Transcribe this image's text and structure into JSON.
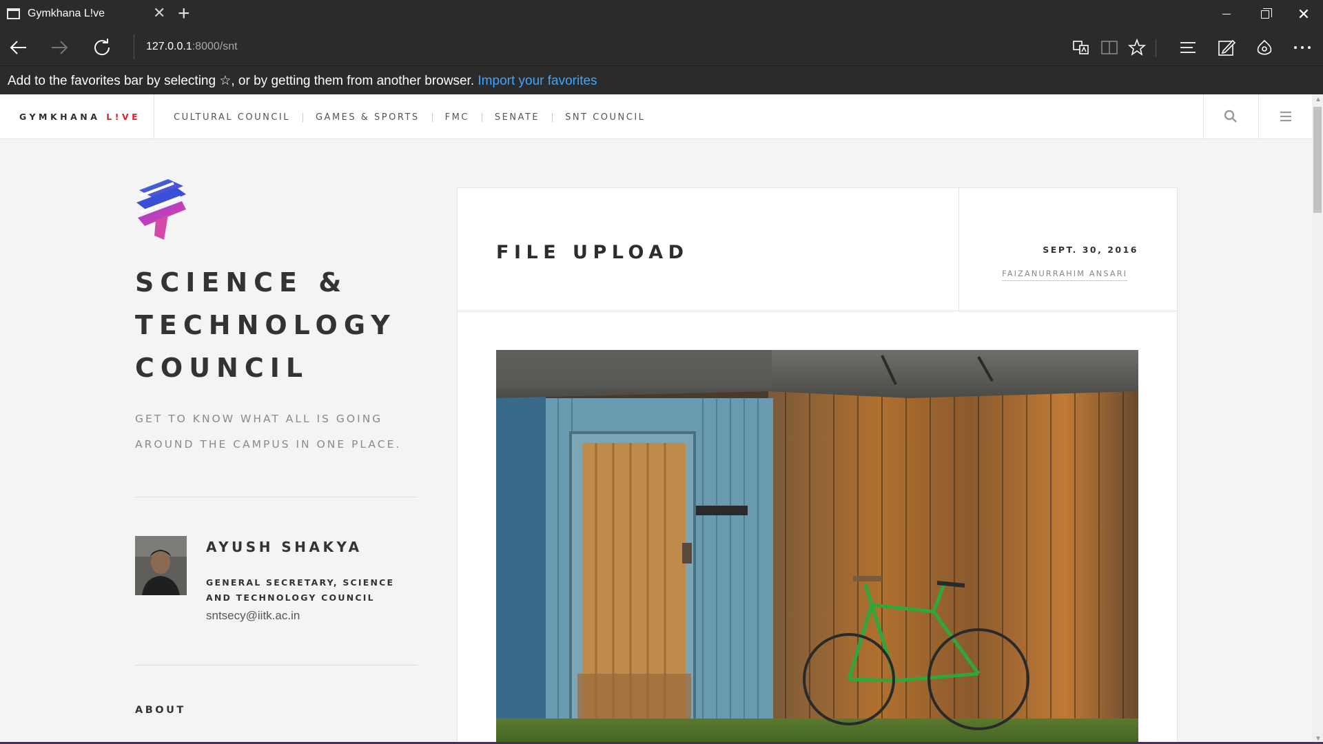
{
  "browser": {
    "tab_title": "Gymkhana L!ve",
    "url_host": "127.0.0.1",
    "url_rest": ":8000/snt",
    "favorites_bar": {
      "text": "Add to the favorites bar by selecting ☆, or by getting them from another browser.",
      "link": "Import your favorites"
    }
  },
  "site": {
    "brand_main": "GYMKHANA ",
    "brand_live": "L!VE",
    "nav": [
      {
        "label": "CULTURAL COUNCIL"
      },
      {
        "label": "GAMES & SPORTS"
      },
      {
        "label": "FMC"
      },
      {
        "label": "SENATE"
      },
      {
        "label": "SNT COUNCIL"
      }
    ]
  },
  "sidebar": {
    "title_lines": [
      "SCIENCE &",
      "TECHNOLOGY",
      "COUNCIL"
    ],
    "tagline_lines": [
      "GET TO KNOW WHAT ALL IS GOING",
      "AROUND THE CAMPUS IN ONE PLACE."
    ],
    "person": {
      "name": "AYUSH SHAKYA",
      "role_lines": [
        "GENERAL SECRETARY, SCIENCE",
        "AND TECHNOLOGY COUNCIL"
      ],
      "email": "sntsecy@iitk.ac.in"
    },
    "about": "ABOUT"
  },
  "post": {
    "title": "FILE UPLOAD",
    "date": "SEPT. 30, 2016",
    "author": "FAIZANURRAHIM ANSARI"
  },
  "colors": {
    "accent_live": "#e0202a",
    "link_blue": "#3ea6ff",
    "chrome_bg": "#2b2b2b"
  }
}
